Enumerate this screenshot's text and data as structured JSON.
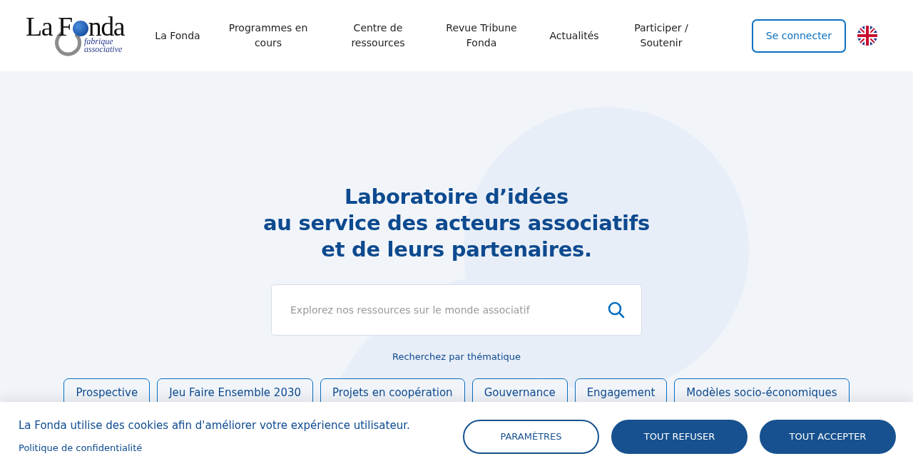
{
  "logo": {
    "name_before": "La F",
    "name_after": "nda",
    "tagline_1": "fabrique",
    "tagline_2": "associative"
  },
  "nav": [
    {
      "label": "La Fonda"
    },
    {
      "label": "Programmes en cours"
    },
    {
      "label": "Centre de ressources"
    },
    {
      "label": "Revue Tribune Fonda"
    },
    {
      "label": "Actualités"
    },
    {
      "label": "Participer / Soutenir"
    }
  ],
  "login_button": "Se connecter",
  "hero": {
    "title_lines": [
      "Laboratoire d’idées",
      "au service des acteurs associatifs",
      "et de leurs partenaires."
    ],
    "search": {
      "placeholder": "Explorez nos ressources sur le monde associatif"
    },
    "theme_link": "Recherchez par thématique"
  },
  "themes": [
    "Prospective",
    "Jeu Faire Ensemble 2030",
    "Projets en coopération",
    "Gouvernance",
    "Engagement",
    "Modèles socio-économiques"
  ],
  "cookie_banner": {
    "message": "La Fonda utilise des cookies afin d'améliorer votre expérience utilisateur.",
    "privacy_link": "Politique de confidentialité",
    "buttons": [
      {
        "label": "PARAMÈTRES",
        "kind": "outline"
      },
      {
        "label": "TOUT REFUSER",
        "kind": "filled"
      },
      {
        "label": "TOUT ACCEPTER",
        "kind": "filled"
      }
    ]
  }
}
